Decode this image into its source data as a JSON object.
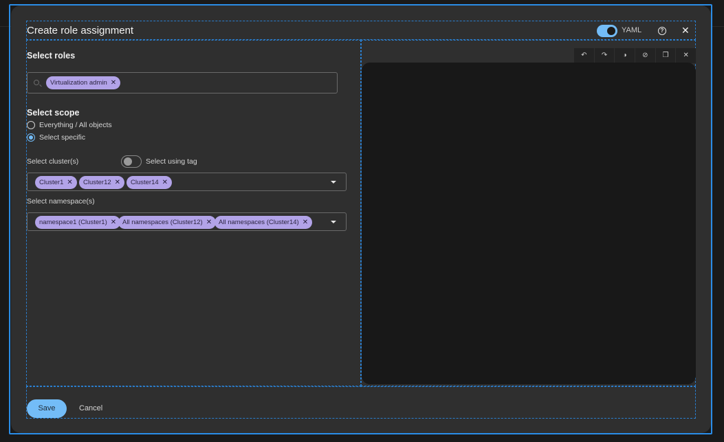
{
  "dialog": {
    "title": "Create role assignment",
    "yaml_label": "YAML",
    "yaml_enabled": true,
    "help_icon": "help-circle-icon",
    "close_glyph": "✕"
  },
  "roles": {
    "heading": "Select roles",
    "chips": [
      {
        "label": "Virtualization admin"
      }
    ]
  },
  "scope": {
    "heading": "Select scope",
    "options": [
      {
        "label": "Everything / All objects",
        "checked": false
      },
      {
        "label": "Select specific",
        "checked": true
      }
    ]
  },
  "clusters": {
    "label": "Select cluster(s)",
    "tag_toggle_label": "Select using tag",
    "tag_toggle_on": false,
    "chips": [
      {
        "label": "Cluster1"
      },
      {
        "label": "Cluster12"
      },
      {
        "label": "Cluster14"
      }
    ]
  },
  "namespaces": {
    "label": "Select namespace(s)",
    "chips": [
      {
        "label": "namespace1 (Cluster1)"
      },
      {
        "label": "All namespaces (Cluster12)"
      },
      {
        "label": "All namespaces (Cluster14)"
      }
    ]
  },
  "editor_toolbar": {
    "buttons": [
      {
        "icon": "undo-icon",
        "glyph": "↶"
      },
      {
        "icon": "redo-icon",
        "glyph": "↷"
      },
      {
        "icon": "theme-icon",
        "glyph": "◑"
      },
      {
        "icon": "hide-icon",
        "glyph": "⊘"
      },
      {
        "icon": "copy-icon",
        "glyph": "❐"
      },
      {
        "icon": "close-icon",
        "glyph": "✕"
      }
    ]
  },
  "footer": {
    "save_label": "Save",
    "cancel_label": "Cancel"
  },
  "colors": {
    "accent": "#73bcf7",
    "chip": "#b2a3e8",
    "modal_bg": "#2f2f2f",
    "editor_bg": "#181818"
  }
}
